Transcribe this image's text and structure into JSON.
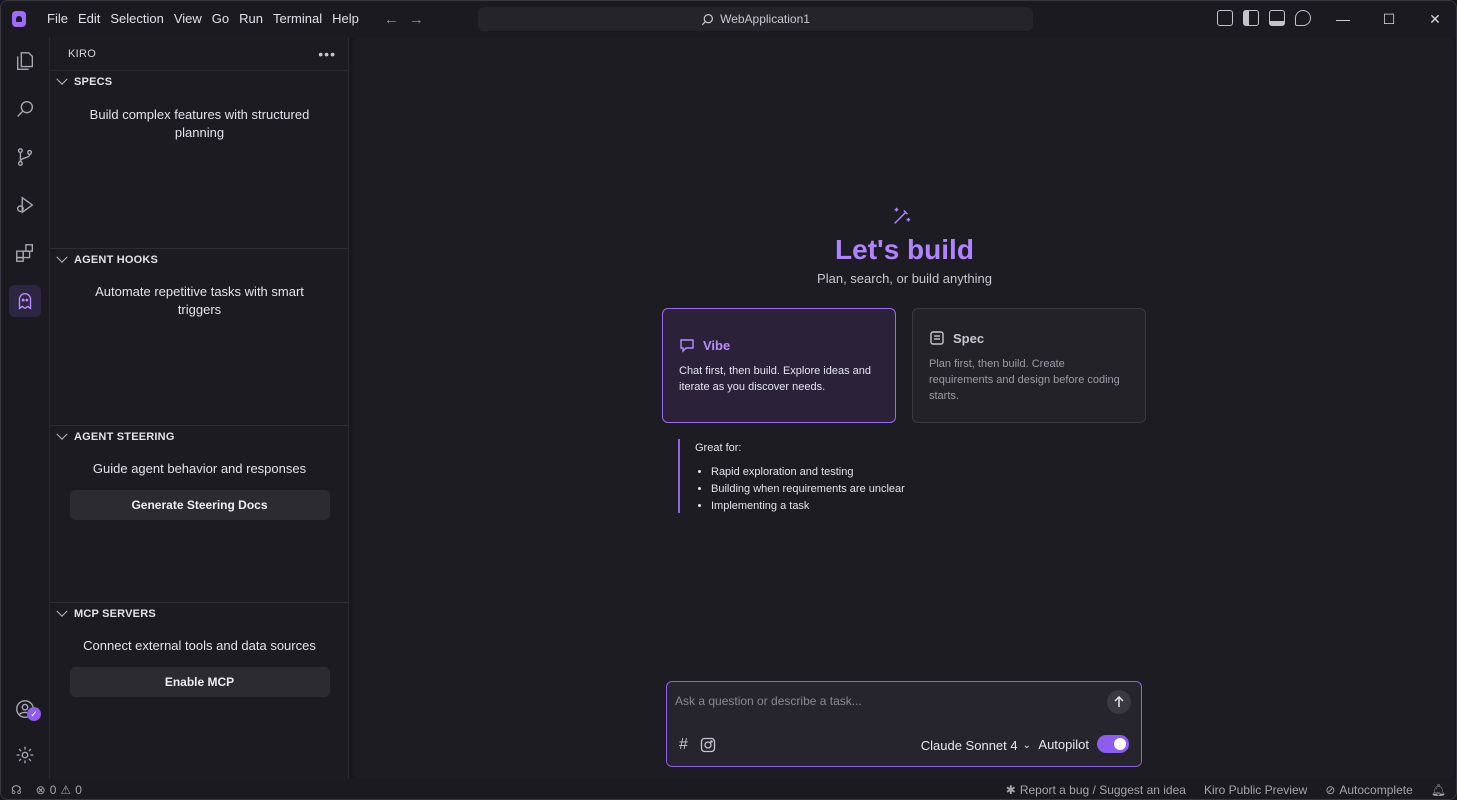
{
  "menu": [
    "File",
    "Edit",
    "Selection",
    "View",
    "Go",
    "Run",
    "Terminal",
    "Help"
  ],
  "search": {
    "label": "WebApplication1"
  },
  "sidebar": {
    "title": "KIRO",
    "sections": [
      {
        "title": "SPECS",
        "desc": "Build complex features with structured planning"
      },
      {
        "title": "AGENT HOOKS",
        "desc": "Automate repetitive tasks with smart triggers"
      },
      {
        "title": "AGENT STEERING",
        "desc": "Guide agent behavior and responses",
        "button": "Generate Steering Docs"
      },
      {
        "title": "MCP SERVERS",
        "desc": "Connect external tools and data sources",
        "button": "Enable MCP"
      }
    ]
  },
  "hero": {
    "title": "Let's build",
    "subtitle": "Plan, search, or build anything"
  },
  "cards": {
    "vibe": {
      "title": "Vibe",
      "desc": "Chat first, then build. Explore ideas and iterate as you discover needs."
    },
    "spec": {
      "title": "Spec",
      "desc": "Plan first, then build. Create requirements and design before coding starts."
    }
  },
  "great_for": {
    "title": "Great for:",
    "items": [
      "Rapid exploration and testing",
      "Building when requirements are unclear",
      "Implementing a task"
    ]
  },
  "chat": {
    "placeholder": "Ask a question or describe a task...",
    "model": "Claude Sonnet 4",
    "autopilot": "Autopilot",
    "autopilot_on": true
  },
  "status": {
    "errors": "0",
    "warnings": "0",
    "report": "Report a bug / Suggest an idea",
    "preview": "Kiro Public Preview",
    "autocomplete": "Autocomplete"
  },
  "colors": {
    "accent": "#b184ff",
    "background": "#1d1c22"
  }
}
